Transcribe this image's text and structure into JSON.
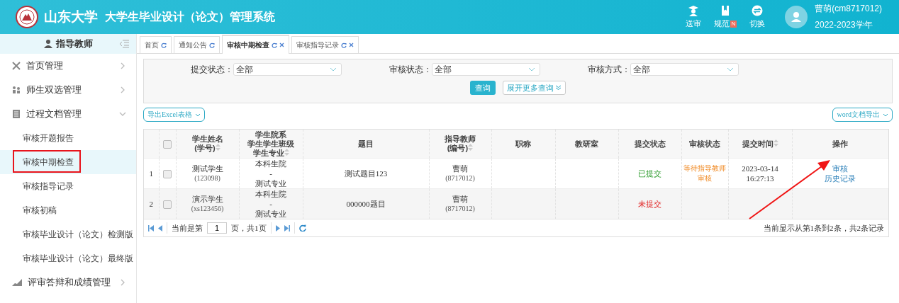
{
  "header": {
    "school": "山东大学",
    "system": "大学生毕业设计（论文）管理系统",
    "actions": [
      {
        "kind": "cap",
        "label": "送审"
      },
      {
        "kind": "book",
        "label": "规范",
        "badge": "N"
      },
      {
        "kind": "switch",
        "label": "切换"
      }
    ],
    "user": {
      "name": "曹萌(cm8717012)",
      "year": "2022-2023学年"
    }
  },
  "sidebar": {
    "role": "指导教师",
    "items": [
      {
        "kind": "tools",
        "label": "首页管理",
        "expanded": false
      },
      {
        "kind": "people",
        "label": "师生双选管理",
        "expanded": false
      },
      {
        "kind": "doc",
        "label": "过程文档管理",
        "expanded": true,
        "children": [
          {
            "label": "审核开题报告",
            "selected": false
          },
          {
            "label": "审核中期检查",
            "selected": true
          },
          {
            "label": "审核指导记录",
            "selected": false
          },
          {
            "label": "审核初稿",
            "selected": false
          },
          {
            "label": "审核毕业设计（论文）检测版",
            "selected": false
          },
          {
            "label": "审核毕业设计（论文）最终版",
            "selected": false
          }
        ]
      },
      {
        "kind": "chart",
        "label": "评审答辩和成绩管理",
        "expanded": false
      }
    ]
  },
  "tabs": [
    {
      "label": "首页",
      "selected": false,
      "closable": false
    },
    {
      "label": "通知公告",
      "selected": false,
      "closable": false
    },
    {
      "label": "审核中期检查",
      "selected": true,
      "closable": true
    },
    {
      "label": "审核指导记录",
      "selected": false,
      "closable": true
    }
  ],
  "filters": [
    {
      "label": "提交状态：",
      "value": "全部"
    },
    {
      "label": "审核状态：",
      "value": "全部"
    },
    {
      "label": "审核方式：",
      "value": "全部"
    }
  ],
  "query_button": "查询",
  "expand_button": "展开更多查询",
  "export_excel": "导出Excel表格",
  "export_word": "word文档导出",
  "table": {
    "select_all_checked": false,
    "columns": [
      {
        "lines": [
          "学生姓名",
          "(学号)"
        ],
        "sortable": true
      },
      {
        "lines": [
          "学生院系",
          "学生学生班级",
          "学生专业"
        ],
        "sortable": true
      },
      {
        "lines": [
          "题目"
        ],
        "sortable": false
      },
      {
        "lines": [
          "指导教师",
          "(编号)"
        ],
        "sortable": true
      },
      {
        "lines": [
          "职称"
        ],
        "sortable": false
      },
      {
        "lines": [
          "教研室"
        ],
        "sortable": false
      },
      {
        "lines": [
          "提交状态"
        ],
        "sortable": false
      },
      {
        "lines": [
          "审核状态"
        ],
        "sortable": false
      },
      {
        "lines": [
          "提交时间"
        ],
        "sortable": true
      },
      {
        "lines": [
          "操作"
        ],
        "sortable": false
      }
    ],
    "rows": [
      {
        "index": "1",
        "checked": false,
        "name": "测试学生",
        "student_id": "(123098)",
        "dept": "本科生院",
        "sep": "-",
        "major": "测试专业",
        "topic": "测试题目123",
        "teacher": "曹萌",
        "teacher_id": "(8717012)",
        "submit": {
          "text": "已提交",
          "kind": "done"
        },
        "review": {
          "lines": [
            "等待指导教师",
            "审核"
          ],
          "kind": "pending"
        },
        "time": [
          "2023-03-14",
          "16:27:13"
        ],
        "actions": [
          "审核",
          "历史记录"
        ]
      },
      {
        "index": "2",
        "checked": false,
        "name": "演示学生",
        "student_id": "(xs123456)",
        "dept": "本科生院",
        "sep": "-",
        "major": "测试专业",
        "topic": "000000题目",
        "teacher": "曹萌",
        "teacher_id": "(8717012)",
        "submit": {
          "text": "未提交",
          "kind": "none"
        }
      }
    ]
  },
  "pager": {
    "prefix": "当前是第",
    "page": "1",
    "suffix": "页，共1页",
    "summary": "当前显示从第1条到2条，共2条记录"
  }
}
